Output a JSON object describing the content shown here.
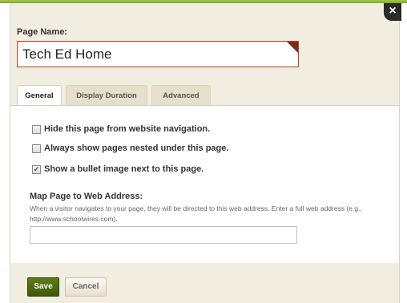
{
  "dialog": {
    "close_glyph": "×"
  },
  "page_name": {
    "label": "Page Name:",
    "value": "Tech Ed Home"
  },
  "tabs": [
    {
      "label": "General",
      "active": true
    },
    {
      "label": "Display Duration",
      "active": false
    },
    {
      "label": "Advanced",
      "active": false
    }
  ],
  "options": [
    {
      "label": "Hide this page from website navigation.",
      "checked": false
    },
    {
      "label": "Always show pages nested under this page.",
      "checked": false
    },
    {
      "label": "Show a bullet image next to this page.",
      "checked": true
    }
  ],
  "map_address": {
    "label": "Map Page to Web Address:",
    "help": "When a visitor navigates to your page, they will be directed to this web address. Enter a full web address (e.g., http://www.schoolwires.com).",
    "value": ""
  },
  "footer": {
    "save_label": "Save",
    "cancel_label": "Cancel"
  },
  "colors": {
    "accent_green": "#3e5a0c",
    "input_border": "#b5431f",
    "dialog_bg": "#f1ede1"
  }
}
